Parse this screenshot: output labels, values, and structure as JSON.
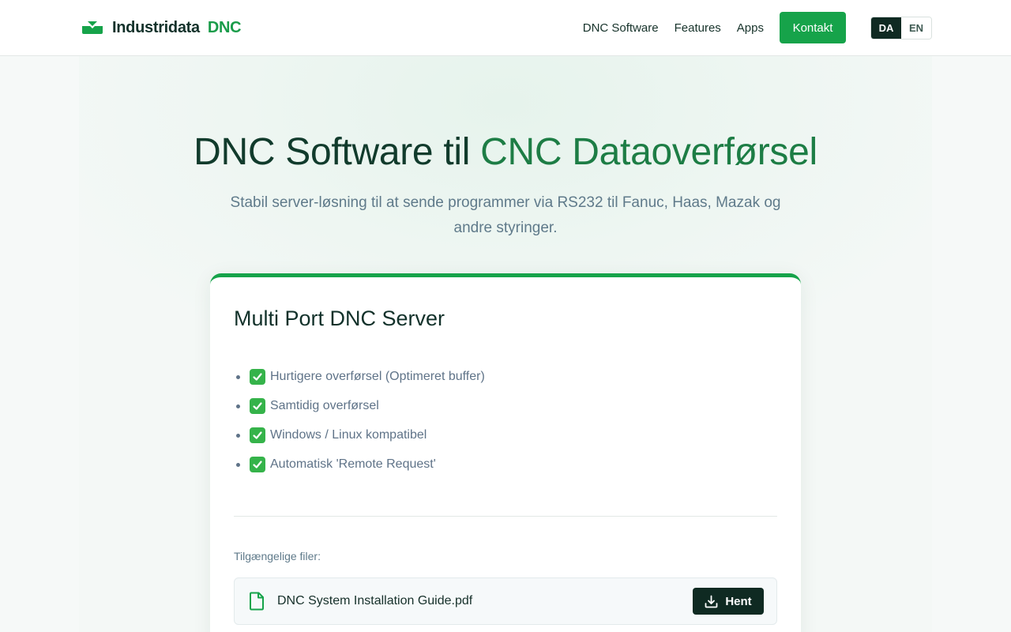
{
  "header": {
    "brand_name": "Industridata",
    "brand_accent": "DNC",
    "nav": [
      {
        "label": "DNC Software"
      },
      {
        "label": "Features"
      },
      {
        "label": "Apps"
      }
    ],
    "contact_label": "Kontakt",
    "languages": [
      {
        "code": "DA",
        "active": true
      },
      {
        "code": "EN",
        "active": false
      }
    ]
  },
  "hero": {
    "title_main": "DNC Software til ",
    "title_accent": "CNC Dataoverførsel",
    "subtitle": "Stabil server-løsning til at sende programmer via RS232 til Fanuc, Haas, Mazak og andre styringer."
  },
  "card": {
    "title": "Multi Port DNC Server",
    "features": [
      "Hurtigere overførsel (Optimeret buffer)",
      "Samtidig overførsel",
      "Windows / Linux kompatibel",
      "Automatisk 'Remote Request'"
    ],
    "files_label": "Tilgængelige filer:",
    "files": [
      {
        "name": "DNC System Installation Guide.pdf",
        "action": "Hent",
        "icon": "document-icon"
      }
    ]
  },
  "colors": {
    "brand_green": "#16a34a",
    "dark": "#0f2a22",
    "muted_text": "#5f7a8a"
  }
}
